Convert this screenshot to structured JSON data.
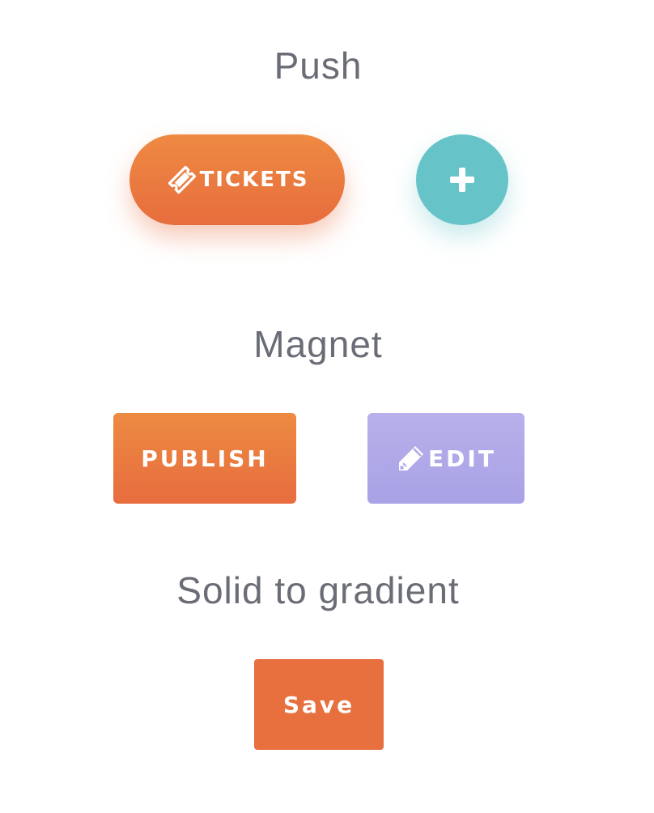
{
  "sections": {
    "push": {
      "title": "Push",
      "tickets_label": "TICKETS",
      "tickets_icon": "ticket-icon",
      "add_icon": "plus-icon"
    },
    "magnet": {
      "title": "Magnet",
      "publish_label": "PUBLISH",
      "edit_label": "EDIT",
      "edit_icon": "pencil-icon"
    },
    "solid_to_gradient": {
      "title": "Solid to gradient",
      "save_label": "Save"
    }
  },
  "colors": {
    "orange": "#e7703e",
    "orange_light": "#ee8a42",
    "teal": "#66c4c8",
    "lavender": "#aea8e8",
    "title_gray": "#6b6d76"
  }
}
